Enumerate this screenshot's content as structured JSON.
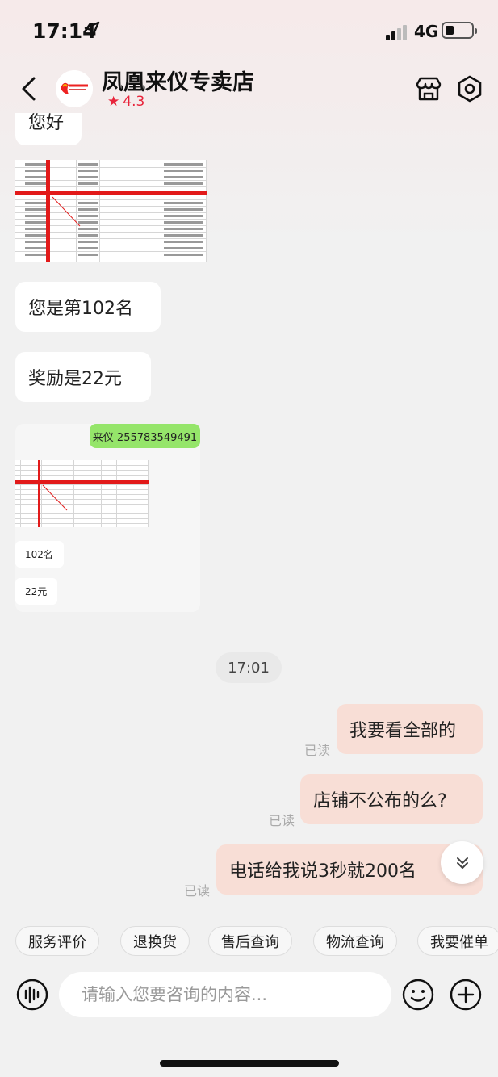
{
  "status_bar": {
    "time": "17:14",
    "network": "4G"
  },
  "header": {
    "shop_name": "凤凰来仪专卖店",
    "rating": "4.3"
  },
  "messages": {
    "partial_top": "您好",
    "rank": "您是第102名",
    "reward": "奖励是22元"
  },
  "quoted_card": {
    "tag": "来仪 255783549491",
    "rank": "102名",
    "reward": "22元"
  },
  "timestamp": "17:01",
  "outgoing": [
    {
      "text": "我要看全部的",
      "status": "已读"
    },
    {
      "text": "店铺不公布的么?",
      "status": "已读"
    },
    {
      "text": "电话给我说3秒就200名",
      "status": "已读"
    }
  ],
  "quick_replies": [
    "服务评价",
    "退换货",
    "售后查询",
    "物流查询",
    "我要催单"
  ],
  "input": {
    "placeholder": "请输入您要咨询的内容..."
  },
  "colors": {
    "accent_red": "#e8233a",
    "outgoing_bubble": "#f8ded6",
    "tag_green": "#95e56a"
  },
  "icons": [
    "location-arrow-icon",
    "signal-icon",
    "battery-icon",
    "back-icon",
    "store-icon",
    "settings-icon",
    "scroll-down-icon",
    "voice-icon",
    "emoji-icon",
    "plus-icon"
  ]
}
